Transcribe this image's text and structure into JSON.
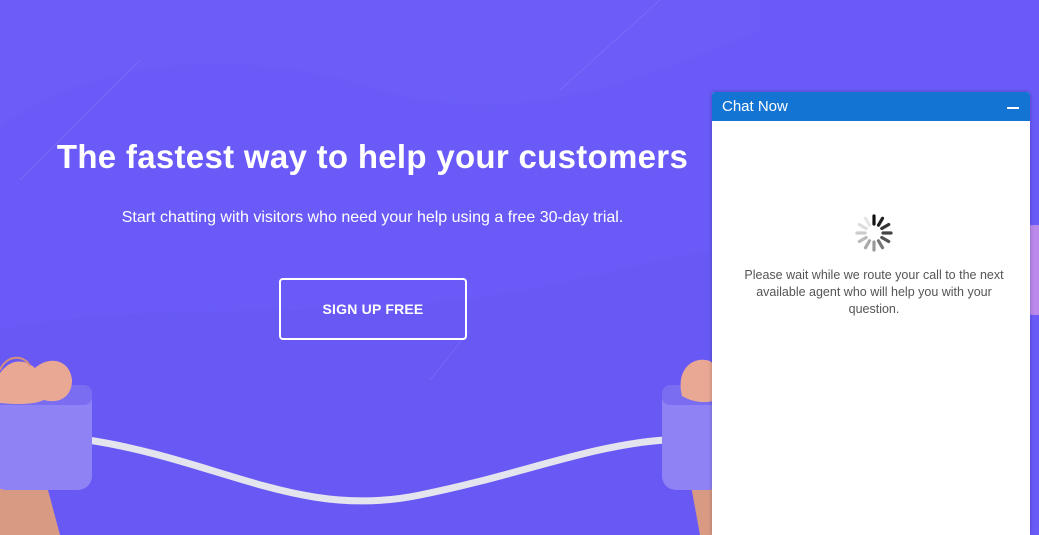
{
  "hero": {
    "title": "The fastest way to help your customers",
    "subtitle": "Start chatting with visitors who need your help using a free 30-day trial.",
    "cta_label": "SIGN UP FREE",
    "background_color": "#6a5bf8"
  },
  "chat_widget": {
    "title": "Chat Now",
    "header_color": "#1474d4",
    "minimize_icon": "minus-icon",
    "status_icon": "loading-spinner-icon",
    "message": "Please wait while we route your call to the next available agent who will help you with your question."
  }
}
